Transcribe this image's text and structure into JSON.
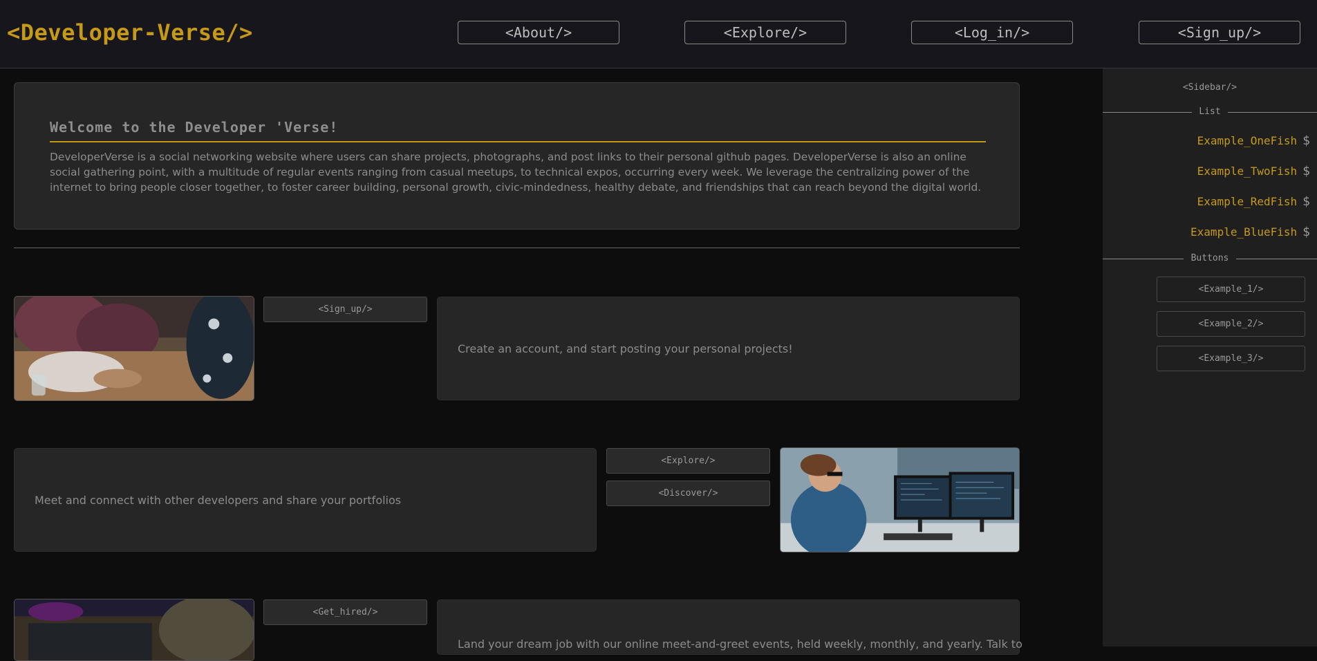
{
  "header": {
    "brand": "<Developer-Verse/>",
    "nav": [
      "<About/>",
      "<Explore/>",
      "<Log_in/>",
      "<Sign_up/>"
    ]
  },
  "welcome": {
    "title": "Welcome to the Developer 'Verse!",
    "body": "DeveloperVerse is a social networking website where users can share projects, photographs, and post links to their personal github pages. DeveloperVerse is also an online social gathering point, with a multitude of regular events ranging from casual meetups, to technical expos, occurring every week. We leverage the centralizing power of the internet to bring people closer together, to foster career building, personal growth, civic-mindedness, healthy debate, and friendships that can reach beyond the digital world."
  },
  "rows": [
    {
      "buttons": [
        "<Sign_up/>"
      ],
      "text": "Create an account, and start posting your personal projects!"
    },
    {
      "buttons": [
        "<Explore/>",
        "<Discover/>"
      ],
      "text": "Meet and connect with other developers and share your portfolios"
    },
    {
      "buttons": [
        "<Get_hired/>"
      ],
      "text": "Land your dream job with our online meet-and-greet events, held weekly, monthly, and yearly. Talk to"
    }
  ],
  "sidebar": {
    "title": "<Sidebar/>",
    "list_label": "List",
    "items": [
      "Example_OneFish",
      "Example_TwoFish",
      "Example_RedFish",
      "Example_BlueFish"
    ],
    "item_icon": "$",
    "buttons_label": "Buttons",
    "buttons": [
      "<Example_1/>",
      "<Example_2/>",
      "<Example_3/>"
    ]
  },
  "colors": {
    "accent": "#c69a17",
    "header_bg": "#17161c",
    "panel_bg": "#262626",
    "page_bg": "#0d0d0d"
  }
}
